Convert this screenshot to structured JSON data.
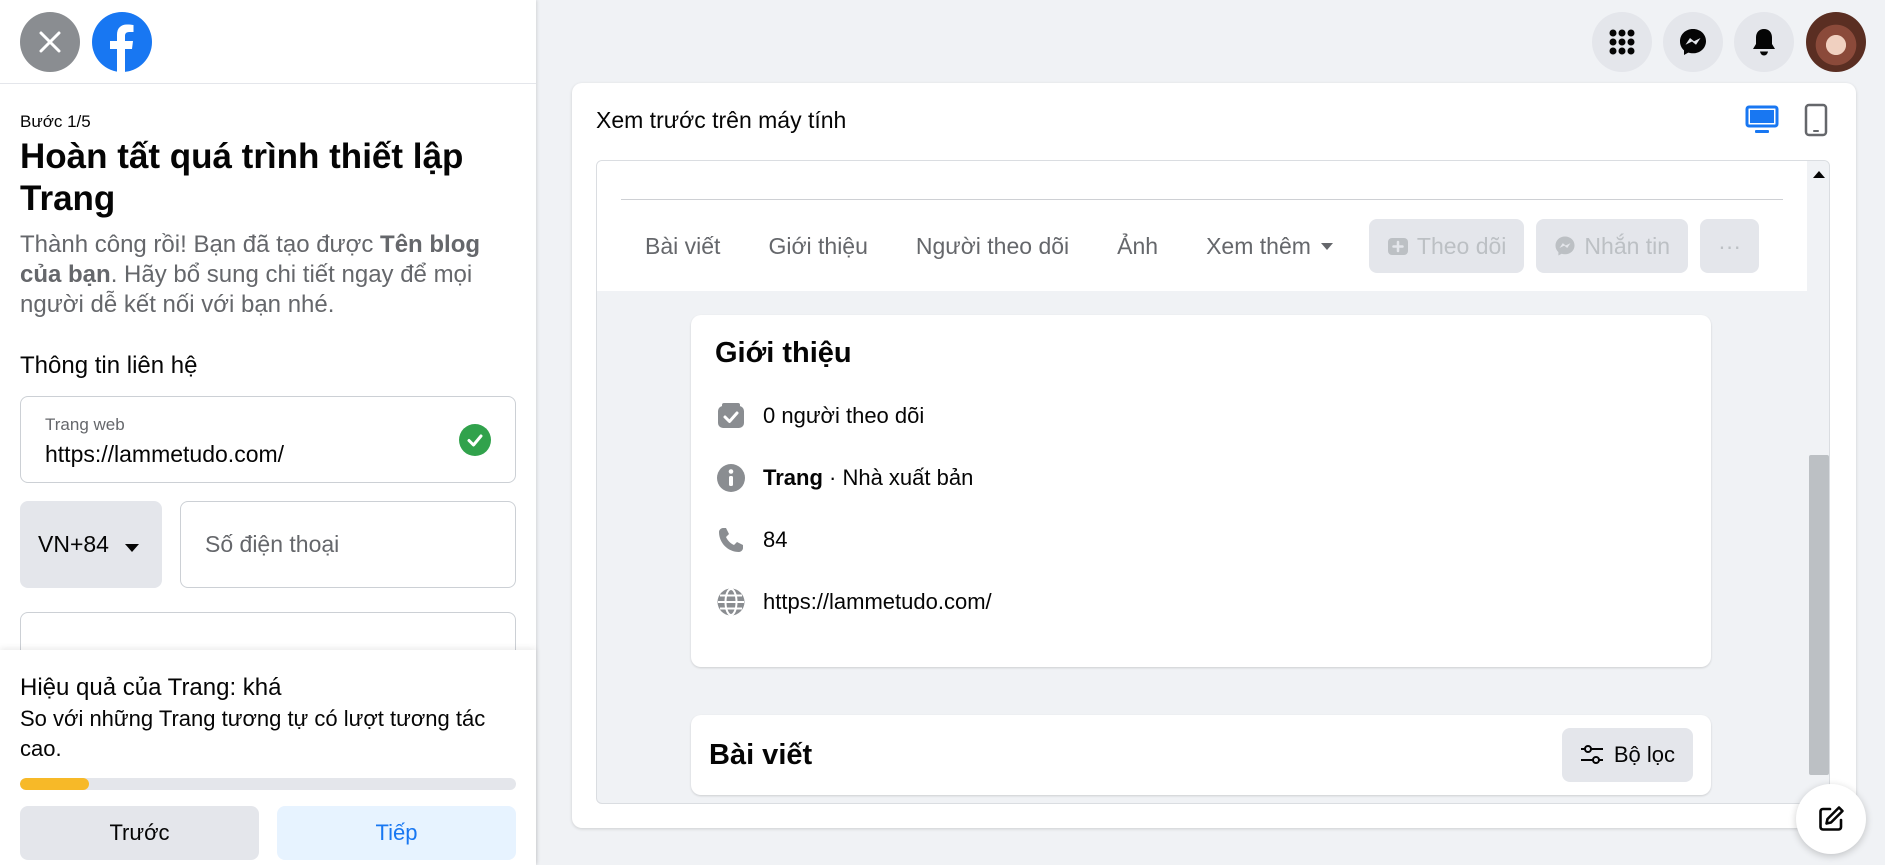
{
  "left": {
    "step": "Bước 1/5",
    "title": "Hoàn tất quá trình thiết lập Trang",
    "desc_a": "Thành công rồi! Bạn đã tạo được ",
    "desc_b": "Tên blog của bạn",
    "desc_c": ". Hãy bổ sung chi tiết ngay để mọi người dễ kết nối với bạn nhé.",
    "contact_heading": "Thông tin liên hệ",
    "website_label": "Trang web",
    "website_value": "https://lammetudo.com/",
    "country_code": "VN+84",
    "phone_placeholder": "Số điện thoại",
    "perf_title": "Hiệu quả của Trang: khá",
    "perf_desc": "So với những Trang tương tự có lượt tương tác cao.",
    "perf_progress_fraction": 0.14,
    "prev_label": "Trước",
    "next_label": "Tiếp"
  },
  "preview": {
    "heading": "Xem trước trên máy tính",
    "nav": [
      "Bài viết",
      "Giới thiệu",
      "Người theo dõi",
      "Ảnh",
      "Xem thêm"
    ],
    "follow_label": "Theo dõi",
    "message_label": "Nhắn tin",
    "more_label": "···",
    "intro_title": "Giới thiệu",
    "followers": "0 người theo dõi",
    "category_bold": "Trang",
    "category_rest": " · Nhà xuất bản",
    "phone": "84",
    "website": "https://lammetudo.com/",
    "posts_title": "Bài viết",
    "filter_label": "Bộ lọc"
  },
  "colors": {
    "accent": "#1877f2",
    "progress": "#f7b928",
    "success": "#31a24c"
  }
}
